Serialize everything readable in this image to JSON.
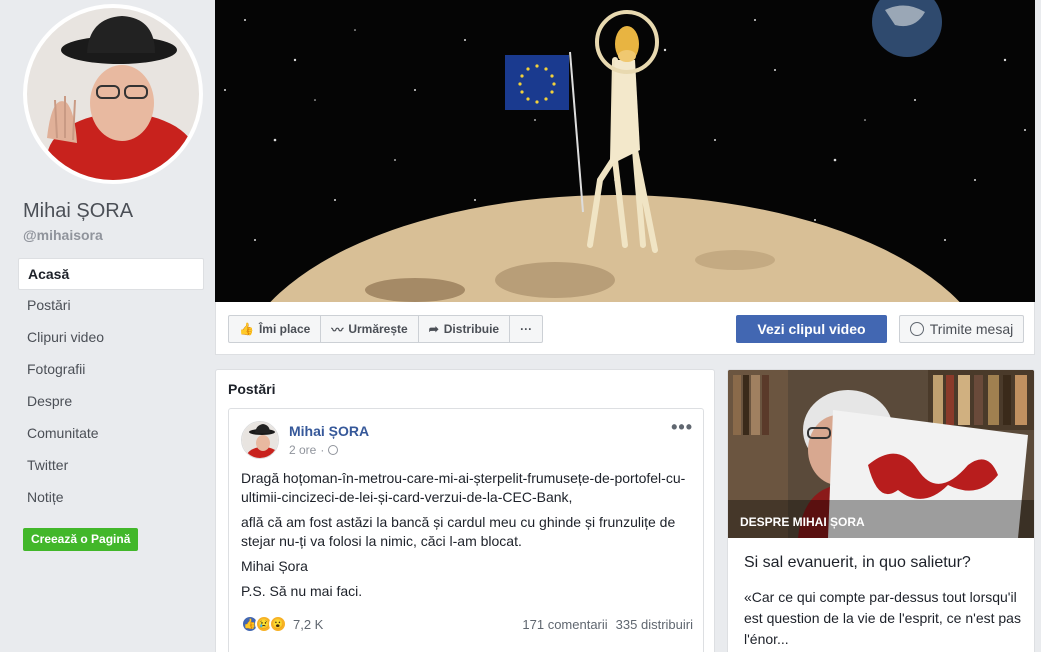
{
  "page": {
    "name": "Mihai ȘORA",
    "handle": "@mihaisora"
  },
  "sidebar": {
    "items": [
      {
        "label": "Acasă",
        "active": true
      },
      {
        "label": "Postări"
      },
      {
        "label": "Clipuri video"
      },
      {
        "label": "Fotografii"
      },
      {
        "label": "Despre"
      },
      {
        "label": "Comunitate"
      },
      {
        "label": "Twitter"
      },
      {
        "label": "Notițe"
      }
    ],
    "create_page_label": "Creează o Pagină"
  },
  "actions": {
    "like": "Îmi place",
    "follow": "Urmărește",
    "share": "Distribuie",
    "more": "···",
    "video_button": "Vezi clipul video",
    "message_button": "Trimite mesaj"
  },
  "posts_section": {
    "title": "Postări"
  },
  "post": {
    "author": "Mihai ȘORA",
    "time": "2 ore",
    "more": "•••",
    "paragraphs": [
      "Dragă hoțoman-în-metrou-care-mi-ai-șterpelit-frumusețe-de-portofel-cu-ultimii-cincizeci-de-lei-și-card-verzui-de-la-CEC-Bank,",
      "află că am fost astăzi la bancă și cardul meu cu ghinde și frunzulițe de stejar nu-ți va folosi la nimic, căci l-am blocat.",
      "Mihai Șora",
      "P.S. Să nu mai faci."
    ],
    "reactions_count": "7,2 K",
    "comments": "171 comentarii",
    "shares": "335 distribuiri"
  },
  "about": {
    "label": "DESPRE MIHAI ȘORA",
    "quote_title": "Si sal evanuerit, in quo salietur?",
    "quote_text": "«Car ce qui compte par-dessus tout lorsqu'il est question de la vie de l'esprit, ce n'est pas l'énor..."
  },
  "colors": {
    "accent": "#4267b2",
    "link": "#365899",
    "green": "#42b72a",
    "background": "#e9ebee"
  }
}
